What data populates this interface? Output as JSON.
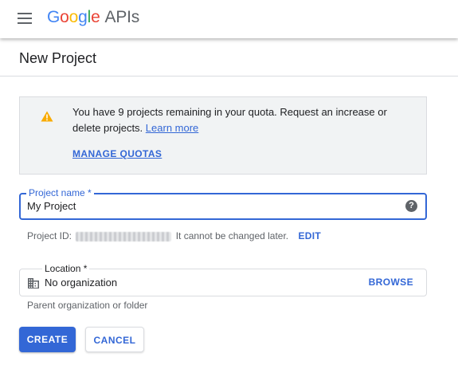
{
  "header": {
    "logo_letters": [
      "G",
      "o",
      "o",
      "g",
      "l",
      "e"
    ],
    "logo_suffix": "APIs",
    "icons": {
      "menu": "hamburger-menu-icon"
    }
  },
  "page": {
    "title": "New Project"
  },
  "quota_notice": {
    "message": "You have 9 projects remaining in your quota. Request an increase or delete projects.",
    "learn_more": "Learn more",
    "manage_quotas": "MANAGE QUOTAS",
    "icon": "warning-icon"
  },
  "project_name": {
    "label": "Project name *",
    "value": "My Project",
    "help_glyph": "?"
  },
  "project_id": {
    "prefix": "Project ID:",
    "suffix": "It cannot be changed later.",
    "edit": "EDIT"
  },
  "location": {
    "label": "Location *",
    "value": "No organization",
    "browse": "BROWSE",
    "helper": "Parent organization or folder",
    "icon": "building-icon"
  },
  "actions": {
    "create": "CREATE",
    "cancel": "CANCEL"
  },
  "colors": {
    "accent": "#3367d6",
    "warning": "#f9ab00",
    "google_blue": "#4285F4",
    "google_red": "#EA4335",
    "google_yellow": "#FBBC05",
    "google_green": "#34A853"
  }
}
